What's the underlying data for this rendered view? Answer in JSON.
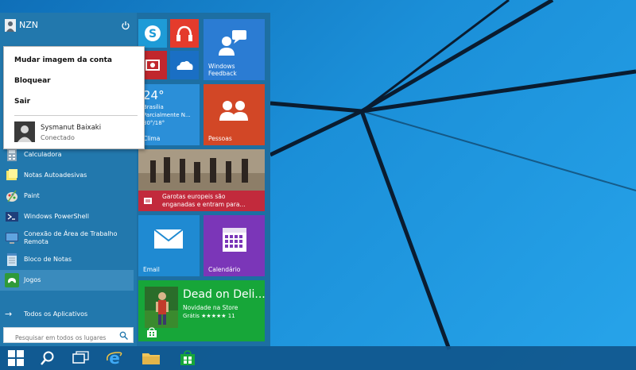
{
  "user": {
    "name": "NZN"
  },
  "account_menu": {
    "items": [
      "Mudar imagem da conta",
      "Bloquear",
      "Sair"
    ],
    "other_user": {
      "name": "Sysmanut Baixaki",
      "status": "Conectado"
    }
  },
  "apps": [
    {
      "label": "Calculadora",
      "icon": "calculator-icon"
    },
    {
      "label": "Notas Autoadesivas",
      "icon": "sticky-notes-icon"
    },
    {
      "label": "Paint",
      "icon": "paint-icon"
    },
    {
      "label": "Windows PowerShell",
      "icon": "powershell-icon"
    },
    {
      "label": "Conexão de Área de Trabalho\nRemota",
      "icon": "remote-desktop-icon"
    },
    {
      "label": "Bloco de Notas",
      "icon": "notepad-icon"
    },
    {
      "label": "Jogos",
      "icon": "games-icon"
    }
  ],
  "all_apps_label": "Todos os Aplicativos",
  "search": {
    "placeholder": "Pesquisar em todos os lugares"
  },
  "tiles": {
    "feedback": {
      "label": "Windows\nFeedback"
    },
    "weather": {
      "temp": "24°",
      "city": "Brasília",
      "desc": "Parcialmente N...",
      "range": "30°/18°",
      "label": "Clima"
    },
    "people": {
      "label": "Pessoas"
    },
    "news": {
      "headline": "Garotas europeis são\nenganadas e entram para..."
    },
    "mail": {
      "label": "Email"
    },
    "calendar": {
      "label": "Calendário"
    },
    "store": {
      "title": "Dead on Deli...",
      "subtitle": "Novidade na Store",
      "rating_text": "Grátis ★★★★★ 11"
    }
  },
  "colors": {
    "skype": "#1e9bd7",
    "music": "#e43b2c",
    "video": "#c1272d",
    "onedrive": "#1a6fc4",
    "feedback": "#2b7cd3",
    "weather": "#2b8fd8",
    "people": "#d24726",
    "news_bar": "#c22a3c",
    "mail": "#1f8ad2",
    "calendar": "#7b36b8",
    "store": "#17a639"
  }
}
